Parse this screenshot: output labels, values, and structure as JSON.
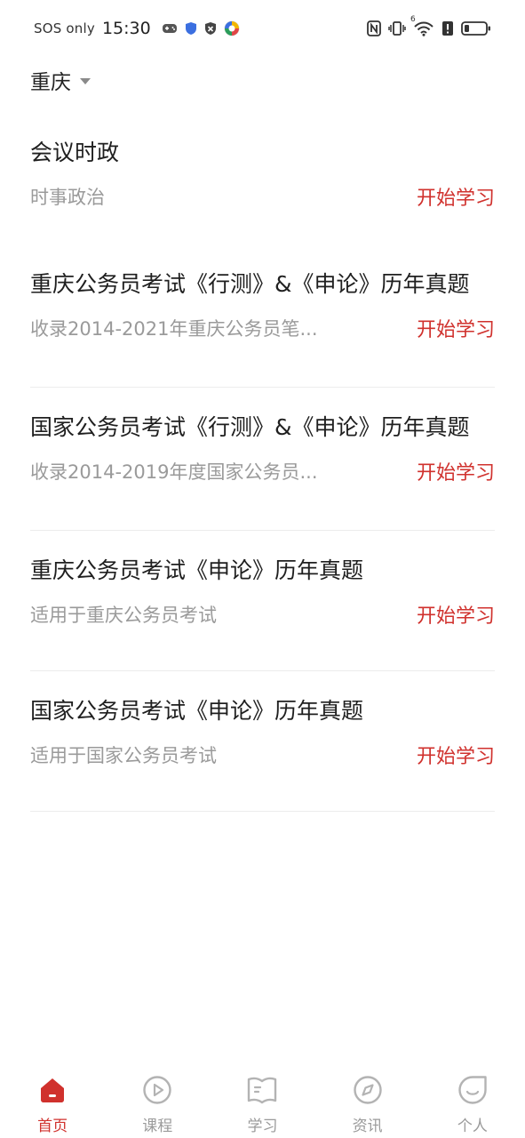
{
  "status_bar": {
    "sos": "SOS only",
    "time": "15:30",
    "network_label": "6"
  },
  "location": {
    "name": "重庆"
  },
  "items": [
    {
      "title": "会议时政",
      "subtitle": "时事政治",
      "action": "开始学习"
    },
    {
      "title": "重庆公务员考试《行测》&《申论》历年真题",
      "subtitle": "收录2014-2021年重庆公务员笔...",
      "action": "开始学习"
    },
    {
      "title": "国家公务员考试《行测》&《申论》历年真题",
      "subtitle": "收录2014-2019年度国家公务员...",
      "action": "开始学习"
    },
    {
      "title": "重庆公务员考试《申论》历年真题",
      "subtitle": "适用于重庆公务员考试",
      "action": "开始学习"
    },
    {
      "title": "国家公务员考试《申论》历年真题",
      "subtitle": "适用于国家公务员考试",
      "action": "开始学习"
    }
  ],
  "bottom_nav": [
    {
      "label": "首页",
      "icon": "home-icon",
      "active": true
    },
    {
      "label": "课程",
      "icon": "play-circle-icon",
      "active": false
    },
    {
      "label": "学习",
      "icon": "book-icon",
      "active": false
    },
    {
      "label": "资讯",
      "icon": "compass-icon",
      "active": false
    },
    {
      "label": "个人",
      "icon": "smile-icon",
      "active": false
    }
  ],
  "colors": {
    "accent": "#d0312d",
    "muted": "#9a9a9a",
    "text": "#1f1f1f"
  }
}
